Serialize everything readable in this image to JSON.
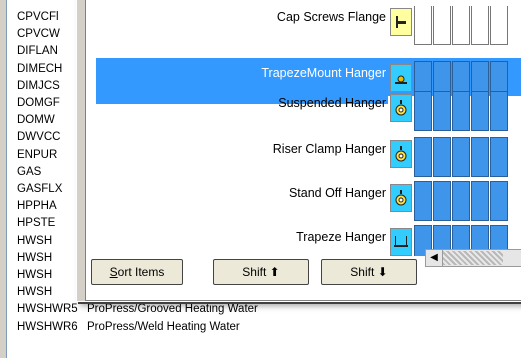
{
  "background_list": {
    "rows": [
      {
        "code": "CPVCFl",
        "desc": ""
      },
      {
        "code": "CPVCW",
        "desc": ""
      },
      {
        "code": "DIFLAN",
        "desc": ""
      },
      {
        "code": "DIMECH",
        "desc": ""
      },
      {
        "code": "DIMJCS",
        "desc": ""
      },
      {
        "code": "DOMGF",
        "desc": ""
      },
      {
        "code": "DOMW",
        "desc": ""
      },
      {
        "code": "DWVCC",
        "desc": ""
      },
      {
        "code": "ENPUR",
        "desc": ""
      },
      {
        "code": "GAS",
        "desc": ""
      },
      {
        "code": "GASFLX",
        "desc": ""
      },
      {
        "code": "HPPHA",
        "desc": ""
      },
      {
        "code": "HPSTE",
        "desc": ""
      },
      {
        "code": "HWSH",
        "desc": ""
      },
      {
        "code": "HWSH",
        "desc": ""
      },
      {
        "code": "HWSH",
        "desc": ""
      },
      {
        "code": "HWSH",
        "desc": ""
      },
      {
        "code": "HWSHWR5",
        "desc": "ProPress/Grooved Heating Water"
      },
      {
        "code": "HWSHWR6",
        "desc": "ProPress/Weld Heating Water"
      }
    ]
  },
  "items": [
    {
      "label": "Cap Screws Flange",
      "icon": "flange-icon",
      "selected": false,
      "cells": [
        "w",
        "w",
        "w",
        "w",
        "w"
      ]
    },
    {
      "label": "TrapezeMount Hanger",
      "icon": "trapeze-mount-icon",
      "selected": true,
      "cells": [
        "b",
        "b",
        "b",
        "b",
        "b"
      ]
    },
    {
      "label": "Suspended Hanger",
      "icon": "suspended-hanger-icon",
      "selected": false,
      "cells": [
        "b",
        "b",
        "b",
        "b",
        "b"
      ]
    },
    {
      "label": "Riser Clamp Hanger",
      "icon": "riser-clamp-icon",
      "selected": false,
      "cells": [
        "b",
        "b",
        "b",
        "b",
        "b"
      ]
    },
    {
      "label": "Stand Off Hanger",
      "icon": "stand-off-hanger-icon",
      "selected": false,
      "cells": [
        "b",
        "b",
        "b",
        "b",
        "b"
      ]
    },
    {
      "label": "Trapeze Hanger",
      "icon": "trapeze-hanger-icon",
      "selected": false,
      "cells": [
        "b",
        "b",
        "b",
        "b",
        "b"
      ]
    }
  ],
  "buttons": {
    "sort": {
      "underline": "S",
      "rest": "ort Items"
    },
    "shift_up": "Shift ⬆",
    "shift_down": "Shift ⬇"
  },
  "colors": {
    "selection": "#3399ff",
    "cell_blue": "#3f95ea",
    "icon_bg": "#ffffa0",
    "icon_bg_alt": "#33ccff"
  }
}
